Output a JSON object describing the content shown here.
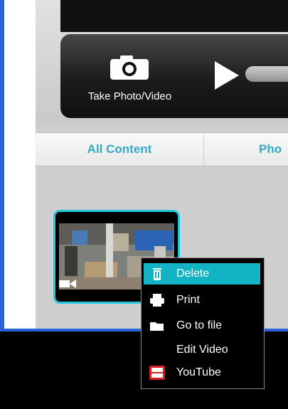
{
  "toolbar": {
    "take_label": "Take Photo/Video"
  },
  "tabs": [
    {
      "label": "All Content"
    },
    {
      "label": "Pho"
    }
  ],
  "context_menu": {
    "items": [
      {
        "label": "Delete",
        "icon": "trash-icon"
      },
      {
        "label": "Print",
        "icon": "printer-icon"
      },
      {
        "label": "Go to file",
        "icon": "folder-icon"
      },
      {
        "label": "Edit Video",
        "icon": ""
      },
      {
        "label": "YouTube",
        "icon": "youtube-icon"
      }
    ]
  },
  "colors": {
    "accent": "#23c8dc",
    "menu_highlight": "#12b4c4",
    "tab_text": "#34aac2",
    "window_border": "#2a63d9"
  }
}
